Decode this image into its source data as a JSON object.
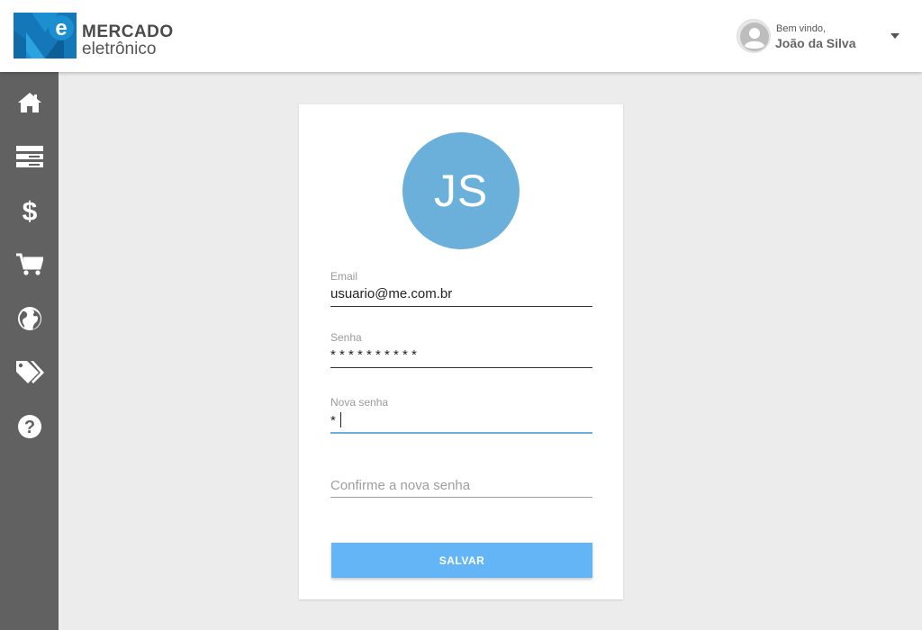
{
  "header": {
    "logo": {
      "line1": "MERCADO",
      "line2": "eletrônico",
      "mark_letter": "e",
      "mark_color": "#1b8fd0"
    },
    "user": {
      "welcome": "Bem vindo,",
      "name": "João da Silva"
    }
  },
  "sidebar": {
    "items": [
      {
        "icon": "home-icon",
        "label": ""
      },
      {
        "icon": "server-icon",
        "label": ""
      },
      {
        "icon": "dollar-icon",
        "label": ""
      },
      {
        "icon": "cart-icon",
        "label": ""
      },
      {
        "icon": "globe-icon",
        "label": ""
      },
      {
        "icon": "tags-icon",
        "label": ""
      },
      {
        "icon": "help-icon",
        "label": ""
      }
    ]
  },
  "form": {
    "avatar_initials": "JS",
    "avatar_color": "#6ab0da",
    "email": {
      "label": "Email",
      "value": "usuario@me.com.br"
    },
    "password": {
      "label": "Senha",
      "value": "* * * * * * * * * *"
    },
    "new_password": {
      "label": "Nova senha",
      "value": "*"
    },
    "confirm_password": {
      "placeholder": "Confirme a nova senha"
    },
    "save_label": "SALVAR",
    "accent_color": "#64b5f6"
  }
}
